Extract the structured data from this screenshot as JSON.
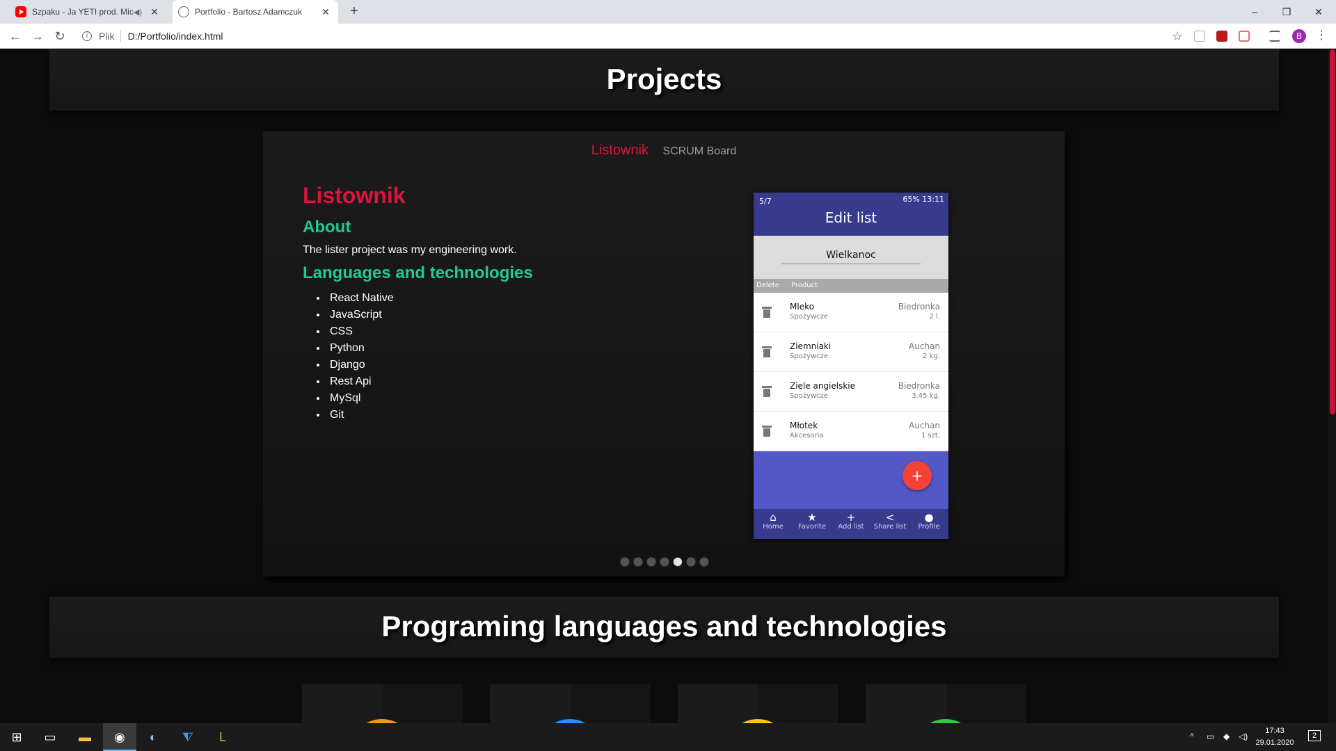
{
  "browser": {
    "tabs": [
      {
        "title": "Szpaku - Ja YETI prod. Micha",
        "active": false
      },
      {
        "title": "Portfolio - Bartosz Adamczuk",
        "active": true
      }
    ],
    "new_tab": "+",
    "address": {
      "protocol": "Plik",
      "url": "D:/Portfolio/index.html"
    },
    "profile_initial": "B",
    "window_controls": {
      "minimize": "–",
      "restore": "❐",
      "close": "✕"
    }
  },
  "page": {
    "projects_heading": "Projects",
    "project_tabs": [
      {
        "label": "Listownik",
        "active": true
      },
      {
        "label": "SCRUM Board",
        "active": false
      }
    ],
    "project": {
      "title": "Listownik",
      "about_heading": "About",
      "about_text": "The lister project was my engineering work.",
      "tech_heading": "Languages and technologies",
      "technologies": [
        "React Native",
        "JavaScript",
        "CSS",
        "Python",
        "Django",
        "Rest Api",
        "MySql",
        "Git"
      ]
    },
    "phone": {
      "counter": "5/7",
      "status": "65% 13:11",
      "title": "Edit list",
      "list_name": "Wielkanoc",
      "col_delete": "Delete",
      "col_product": "Product",
      "items": [
        {
          "name": "Mleko",
          "category": "Spożywcze",
          "shop": "Biedronka",
          "qty": "2 l."
        },
        {
          "name": "Ziemniaki",
          "category": "Spożywcze",
          "shop": "Auchan",
          "qty": "2 kg."
        },
        {
          "name": "Ziele angielskie",
          "category": "Spożywcze",
          "shop": "Biedronka",
          "qty": "3.45 kg."
        },
        {
          "name": "Młotek",
          "category": "Akcesoria",
          "shop": "Auchan",
          "qty": "1 szt."
        }
      ],
      "fab": "+",
      "nav": [
        {
          "label": "Home",
          "icon": "⌂"
        },
        {
          "label": "Favorite",
          "icon": "★"
        },
        {
          "label": "Add list",
          "icon": "+"
        },
        {
          "label": "Share list",
          "icon": "<"
        },
        {
          "label": "Profile",
          "icon": "●"
        }
      ]
    },
    "carousel": {
      "total": 7,
      "active_index": 4
    },
    "tech_heading": "Programing languages and technologies",
    "tech_card_colors": [
      "#f7941d",
      "#1e90ff",
      "#f5c518",
      "#2ecc40"
    ]
  },
  "taskbar": {
    "time": "17:43",
    "date": "29.01.2020",
    "notifications": "2"
  },
  "colors": {
    "accent": "#dc143c",
    "heading_green": "#20c997",
    "app_primary": "#383a8e"
  }
}
